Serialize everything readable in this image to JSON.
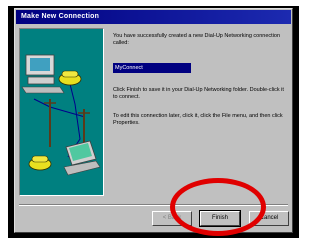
{
  "dialog": {
    "title": "Make New Connection",
    "success_text": "You have successfully created a new Dial-Up Networking connection called:",
    "connection_name": "MyConnect",
    "finish_text": "Click Finish to save it in your Dial-Up Networking folder. Double-click it to connect.",
    "edit_text": "To edit this connection later, click it, click the File menu, and then click Properties."
  },
  "buttons": {
    "back": "< Back",
    "finish": "Finish",
    "cancel": "Cancel"
  },
  "highlight_color": "#e00000",
  "icons": [
    "computer-icon",
    "phone-icon",
    "laptop-icon",
    "telephone-pole-icon"
  ]
}
